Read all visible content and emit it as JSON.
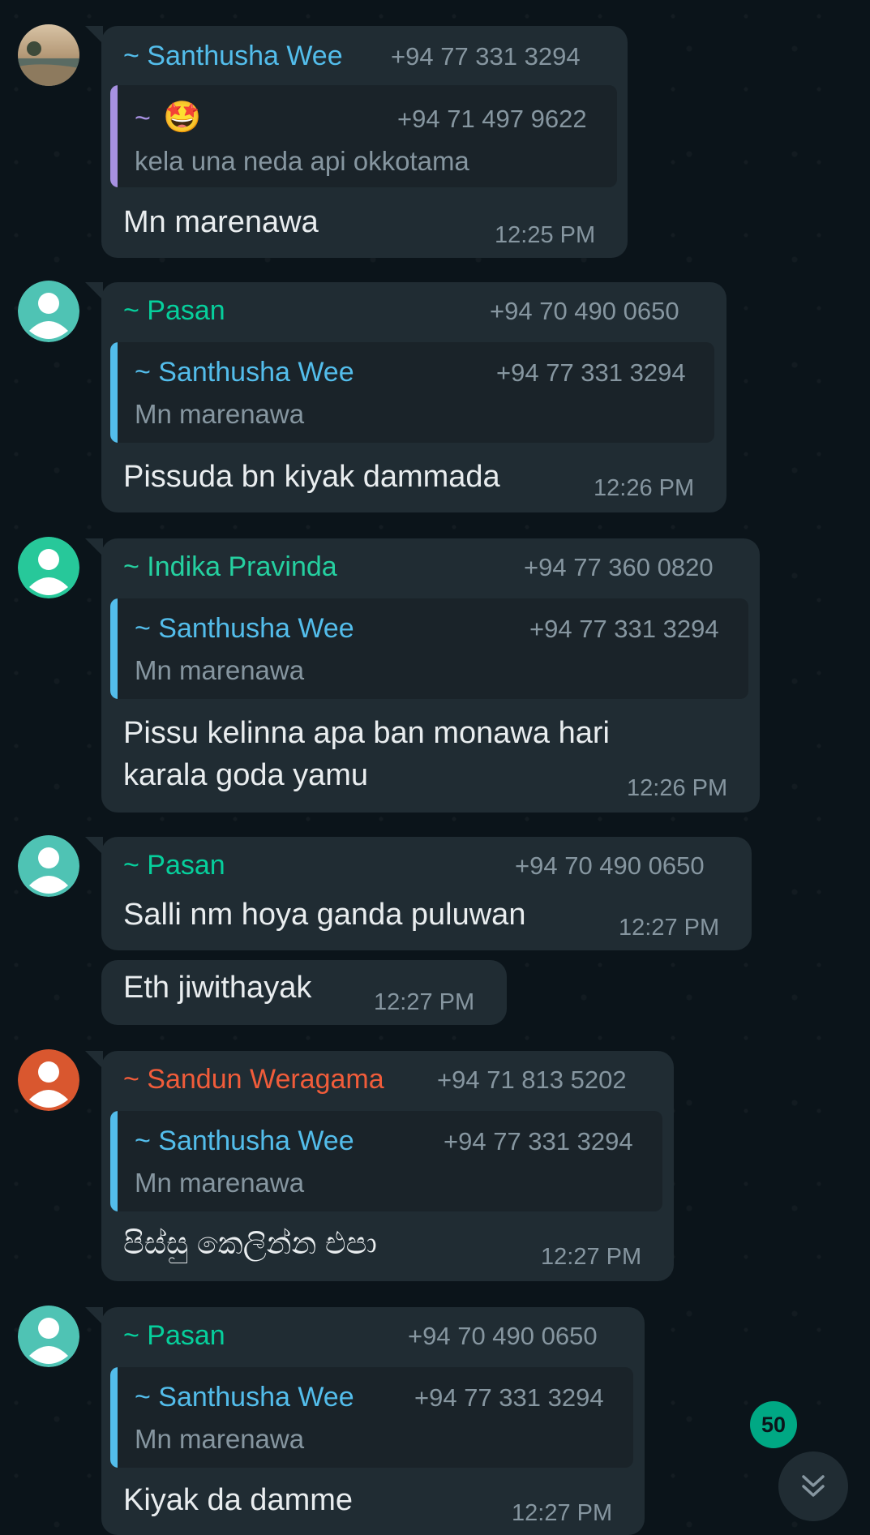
{
  "colors": {
    "background": "#0b141a",
    "bubble": "#202c33",
    "name_blue": "#53bdeb",
    "name_teal": "#06cf9c",
    "name_orange": "#f15c3a",
    "meta_gray": "#8696a0",
    "text_white": "#e9edef",
    "accent_green": "#00a884"
  },
  "messages": [
    {
      "sender": "~ Santhusha Wee",
      "phone": "+94 77 331 3294",
      "quote": {
        "sender": "~",
        "emoji": "🤩",
        "phone": "+94 71 497 9622",
        "text": "kela una neda api okkotama"
      },
      "text": "Mn marenawa",
      "time": "12:25 PM"
    },
    {
      "sender": "~ Pasan",
      "phone": "+94 70 490 0650",
      "quote": {
        "sender": "~ Santhusha Wee",
        "phone": "+94 77 331 3294",
        "text": "Mn marenawa"
      },
      "text": "Pissuda bn kiyak dammada",
      "time": "12:26 PM"
    },
    {
      "sender": "~ Indika Pravinda",
      "phone": "+94 77 360 0820",
      "quote": {
        "sender": "~ Santhusha Wee",
        "phone": "+94 77 331 3294",
        "text": "Mn marenawa"
      },
      "text_line1": "Pissu kelinna apa ban monawa hari",
      "text_line2": "karala goda yamu",
      "time": "12:26 PM"
    },
    {
      "sender": "~ Pasan",
      "phone": "+94 70 490 0650",
      "text": "Salli nm hoya ganda puluwan",
      "time": "12:27 PM"
    },
    {
      "text": "Eth jiwithayak",
      "time": "12:27 PM"
    },
    {
      "sender": "~ Sandun Weragama",
      "phone": "+94 71 813 5202",
      "quote": {
        "sender": "~ Santhusha Wee",
        "phone": "+94 77 331 3294",
        "text": "Mn marenawa"
      },
      "text": "පිස්සු කෙලින්න එපා",
      "time": "12:27 PM"
    },
    {
      "sender": "~ Pasan",
      "phone": "+94 70 490 0650",
      "quote": {
        "sender": "~ Santhusha Wee",
        "phone": "+94 77 331 3294",
        "text": "Mn marenawa"
      },
      "text": "Kiyak da damme",
      "time": "12:27 PM"
    }
  ],
  "unread_badge": "50",
  "icons": {
    "default_avatar": "person-silhouette-icon",
    "scroll_down": "double-chevron-down-icon"
  }
}
